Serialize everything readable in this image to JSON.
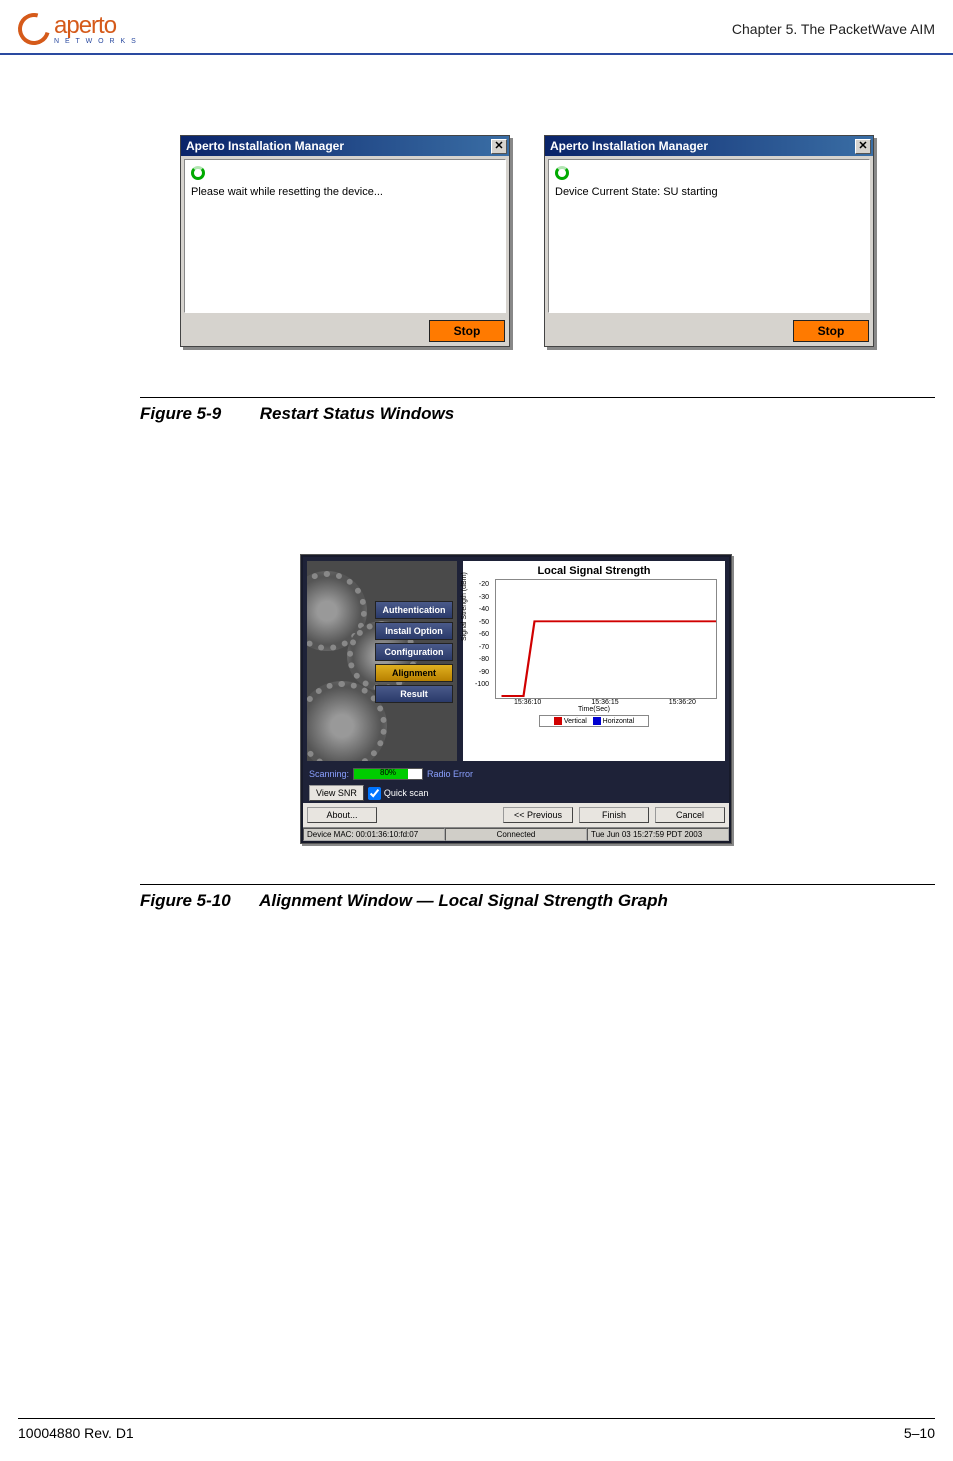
{
  "header": {
    "logo_main": "aperto",
    "logo_sub": "N E T W O R K S",
    "chapter": "Chapter 5.   The PacketWave AIM"
  },
  "dialog_a": {
    "title": "Aperto Installation Manager",
    "message": "Please wait while resetting the device...",
    "button": "Stop",
    "close": "✕"
  },
  "dialog_b": {
    "title": "Aperto Installation Manager",
    "message": "Device Current State: SU starting",
    "button": "Stop",
    "close": "✕"
  },
  "figure_5_9": {
    "num": "Figure 5-9",
    "title": "Restart Status Windows"
  },
  "align": {
    "nav": {
      "auth": "Authentication",
      "install": "Install Option",
      "config": "Configuration",
      "alignment": "Alignment",
      "result": "Result"
    },
    "chart_title": "Local Signal Strength",
    "ylabel": "Signal Strength (dBm)",
    "xlabel": "Time(Sec)",
    "legend": {
      "a": "Vertical",
      "b": "Horizontal"
    },
    "scan_label": "Scanning:",
    "progress_pct": "80%",
    "radio_error": "Radio Error",
    "view_snr": "View SNR",
    "quick_scan": "Quick scan",
    "buttons": {
      "about": "About...",
      "prev": "<< Previous",
      "finish": "Finish",
      "cancel": "Cancel"
    },
    "status": {
      "mac": "Device MAC: 00:01:36:10:fd:07",
      "conn": "Connected",
      "time": "Tue Jun 03 15:27:59 PDT 2003"
    }
  },
  "chart_data": {
    "type": "line",
    "title": "Local Signal Strength",
    "xlabel": "Time(Sec)",
    "ylabel": "Signal Strength (dBm)",
    "ylim": [
      -100,
      -20
    ],
    "x_ticks": [
      "15:36:10",
      "15:36:15",
      "15:36:20"
    ],
    "y_ticks": [
      -20,
      -30,
      -40,
      -50,
      -60,
      -70,
      -80,
      -90,
      -100
    ],
    "series": [
      {
        "name": "Vertical",
        "color": "#d00000",
        "x": [
          "15:36:10",
          "15:36:11",
          "15:36:12",
          "15:36:20"
        ],
        "y": [
          -100,
          -100,
          -48,
          -48
        ]
      },
      {
        "name": "Horizontal",
        "color": "#0000d0",
        "x": [],
        "y": []
      }
    ]
  },
  "figure_5_10": {
    "num": "Figure 5-10",
    "title": "Alignment Window — Local Signal Strength Graph"
  },
  "footer": {
    "left": "10004880 Rev. D1",
    "right": "5–10"
  }
}
